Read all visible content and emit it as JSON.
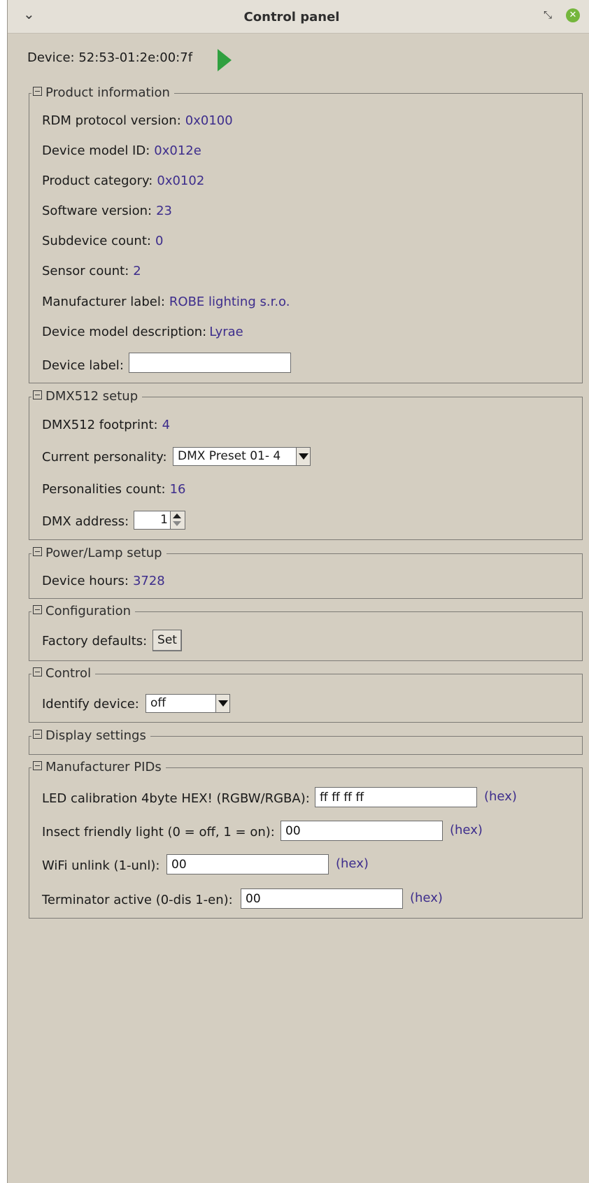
{
  "window": {
    "title": "Control panel",
    "menu_glyph": "⌄",
    "restore_glyph": "⤡",
    "close_glyph": "✕",
    "accent": "#74b63c"
  },
  "device": {
    "label": "Device: 52:53-01:2e:00:7f",
    "play_icon": "play-icon"
  },
  "product_info": {
    "legend": "Product information",
    "rdm_label": "RDM protocol version:",
    "rdm_value": "0x0100",
    "model_id_label": "Device model ID:",
    "model_id_value": "0x012e",
    "category_label": "Product category:",
    "category_value": "0x0102",
    "software_label": "Software version:",
    "software_value": "23",
    "subdevice_label": "Subdevice count:",
    "subdevice_value": "0",
    "sensor_label": "Sensor count:",
    "sensor_value": "2",
    "manufacturer_label": "Manufacturer label:",
    "manufacturer_value": "ROBE lighting s.r.o.",
    "model_desc_label": "Device model description:",
    "model_desc_value": "Lyrae",
    "device_label_label": "Device label:",
    "device_label_value": ""
  },
  "dmx": {
    "legend": "DMX512 setup",
    "footprint_label": "DMX512 footprint:",
    "footprint_value": "4",
    "personality_label": "Current personality:",
    "personality_value": "DMX Preset 01- 4",
    "personalities_label": "Personalities count:",
    "personalities_value": "16",
    "address_label": "DMX address:",
    "address_value": "1"
  },
  "power": {
    "legend": "Power/Lamp setup",
    "hours_label": "Device hours:",
    "hours_value": "3728"
  },
  "configuration": {
    "legend": "Configuration",
    "defaults_label": "Factory defaults:",
    "set_button": "Set"
  },
  "control": {
    "legend": "Control",
    "identify_label": "Identify device:",
    "identify_value": "off"
  },
  "display": {
    "legend": "Display settings"
  },
  "pids": {
    "legend": "Manufacturer PIDs",
    "led_label": "LED calibration 4byte HEX! (RGBW/RGBA):",
    "led_value": "ff ff ff ff",
    "insect_label": "Insect friendly light (0 = off, 1 = on):",
    "insect_value": "00",
    "wifi_label": "WiFi unlink (1-unl):",
    "wifi_value": "00",
    "terminator_label": "Terminator active (0-dis 1-en):",
    "terminator_value": "00",
    "hex_suffix": "(hex)"
  },
  "colors": {
    "value_text": "#3d2d8c",
    "panel_bg": "#d4cec1"
  }
}
